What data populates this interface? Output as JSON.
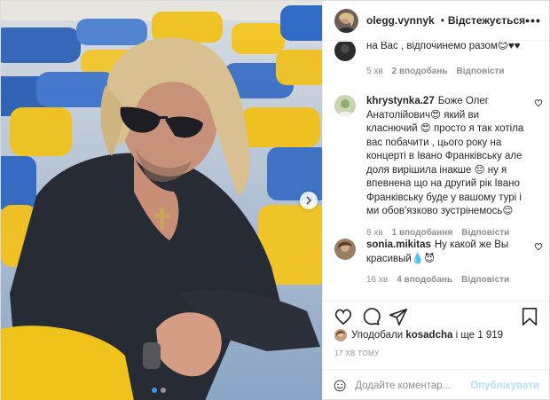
{
  "header": {
    "username": "olegg.vynnyk",
    "separator": "•",
    "follow_label": "Відстежується",
    "more_label": "•••"
  },
  "comments": [
    {
      "user": "",
      "text": "на Вас , відпочинемо разом😊♥♥",
      "time": "5 хв",
      "likes": "2 вподобань",
      "reply": "Відповісти"
    },
    {
      "user": "khrystynka.27",
      "text": "Боже Олег Анатолійович😍 який ви класнючий 😍 просто я так хотіла вас побачити , цього року на концерті в Івано Франківську але доля вирішила інакше 😔 ну я впевнена що на другий рік Івано Франківську буде у вашому турі і ми обов'язково зустрінемось😌",
      "time": "8 хв",
      "likes": "1 вподобання",
      "reply": "Відповісти"
    },
    {
      "user": "sonia.mikitas",
      "text": "Ну какой же Вы красивый💧😈",
      "time": "16 хв",
      "likes": "4 вподобань",
      "reply": "Відповісти"
    }
  ],
  "likes": {
    "prefix": "Уподобали",
    "user": "kosadcha",
    "suffix": "і ще 1 919"
  },
  "time_ago": "17 ХВ ТОМУ",
  "add_comment": {
    "placeholder": "Додайте коментар...",
    "publish_label": "Опублікувати"
  },
  "carousel": {
    "slide": 1,
    "slides": 2
  },
  "colors": {
    "link_blue": "#3897f0",
    "publish_disabled": "#b2dffc",
    "muted": "#8e8e8e",
    "text": "#262626"
  },
  "icons": [
    "heart-icon",
    "comment-icon",
    "share-icon",
    "bookmark-icon",
    "smile-icon",
    "verified-badge-icon",
    "chevron-right-icon"
  ]
}
